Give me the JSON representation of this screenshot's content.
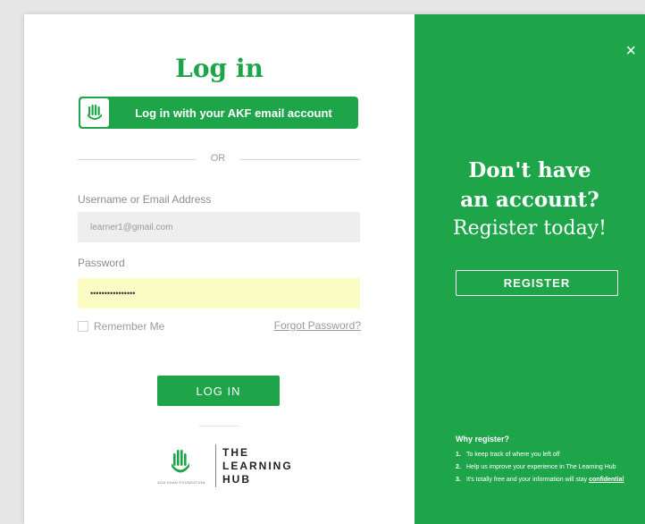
{
  "login": {
    "title": "Log in",
    "sso_button": "Log in with your AKF email account",
    "or": "OR",
    "username_label": "Username or Email Address",
    "username_value": "learner1@gmail.com",
    "password_label": "Password",
    "password_value": "••••••••••••••••",
    "remember_label": "Remember Me",
    "forgot_label": "Forgot Password?",
    "login_button": "LOG IN"
  },
  "logo": {
    "foundation": "AGA KHAN FOUNDATION",
    "line1": "THE",
    "line2": "LEARNING",
    "line3": "HUB"
  },
  "register": {
    "close": "×",
    "headline_line1": "Don't have",
    "headline_line2": "an account?",
    "headline_line3": "Register today!",
    "button": "REGISTER",
    "why_title": "Why register?",
    "reasons": [
      {
        "num": "1.",
        "text": "To keep track of where you left off"
      },
      {
        "num": "2.",
        "text": "Help us improve your experience in The Learning Hub"
      },
      {
        "num": "3.",
        "text": "It's totally free and your information will stay",
        "emphasis": "confidential"
      }
    ]
  },
  "colors": {
    "brand_green": "#1ea54a",
    "autofill_yellow": "#fbfbc4",
    "input_grey": "#eeeeee"
  },
  "icons": [
    "hand-logo-icon",
    "close-icon"
  ]
}
